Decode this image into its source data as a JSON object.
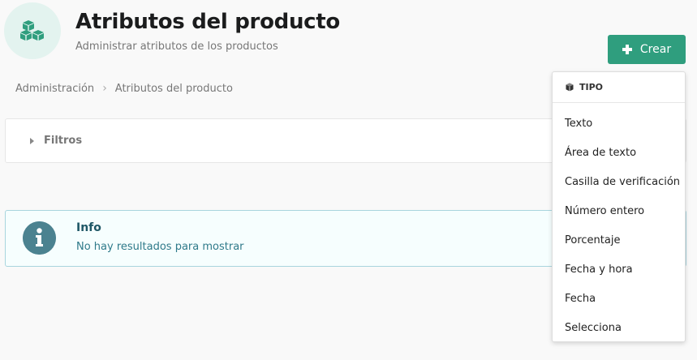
{
  "header": {
    "title": "Atributos del producto",
    "subtitle": "Administrar atributos de los productos",
    "icon": "cubes-icon",
    "icon_color": "#2f9e7e"
  },
  "toolbar": {
    "create_label": "Crear",
    "create_color": "#2f9e7e"
  },
  "breadcrumb": {
    "items": [
      "Administración",
      "Atributos del producto"
    ]
  },
  "filters": {
    "label": "Filtros"
  },
  "info": {
    "title": "Info",
    "message": "No hay resultados para mostrar",
    "icon": "info-icon"
  },
  "dropdown": {
    "header": "TIPO",
    "header_icon": "cube-icon",
    "items": [
      "Texto",
      "Área de texto",
      "Casilla de verificación",
      "Número entero",
      "Porcentaje",
      "Fecha y hora",
      "Fecha",
      "Selecciona"
    ]
  }
}
